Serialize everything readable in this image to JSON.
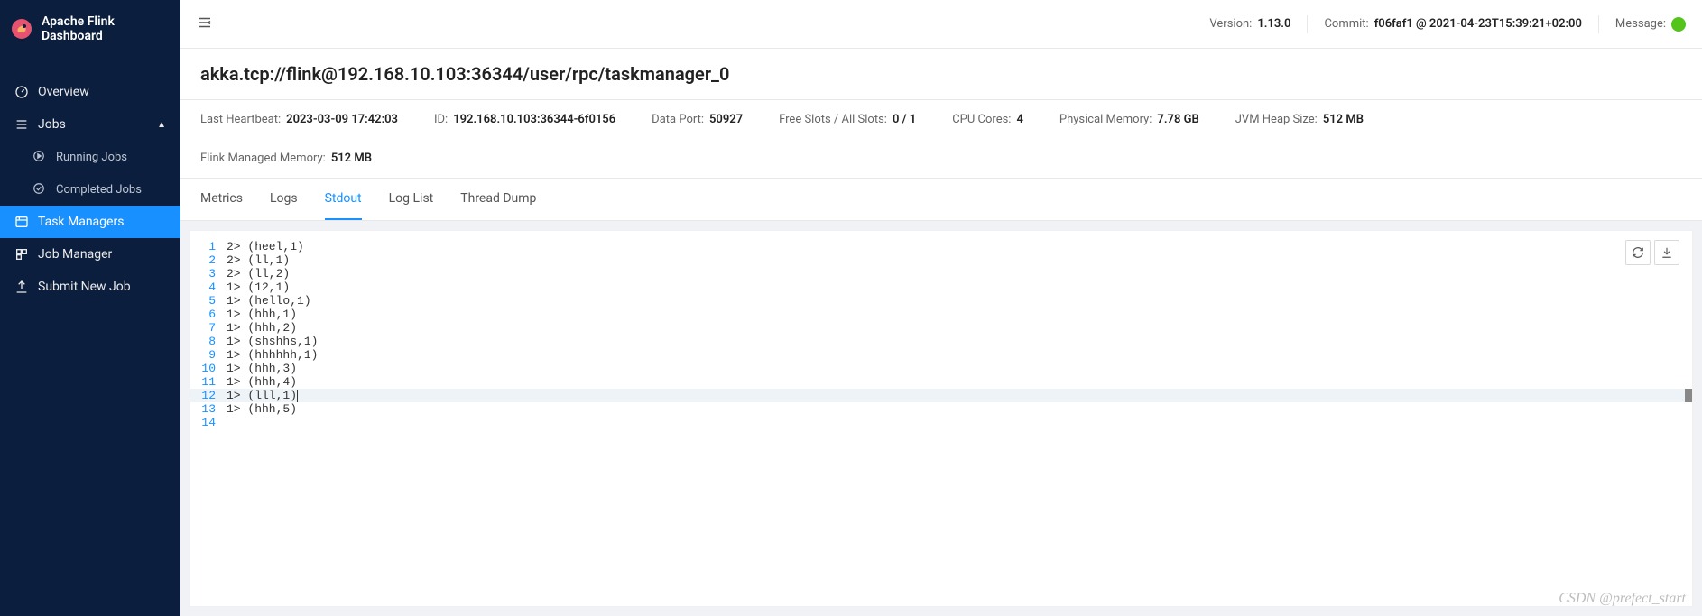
{
  "brand": {
    "title": "Apache Flink Dashboard"
  },
  "sidebar": {
    "overview": "Overview",
    "jobs": "Jobs",
    "running": "Running Jobs",
    "completed": "Completed Jobs",
    "task_managers": "Task Managers",
    "job_manager": "Job Manager",
    "submit": "Submit New Job"
  },
  "topbar": {
    "version_label": "Version:",
    "version": "1.13.0",
    "commit_label": "Commit:",
    "commit": "f06faf1 @ 2021-04-23T15:39:21+02:00",
    "message_label": "Message:"
  },
  "page": {
    "title": "akka.tcp://flink@192.168.10.103:36344/user/rpc/taskmanager_0"
  },
  "stats": {
    "last_heartbeat_label": "Last Heartbeat:",
    "last_heartbeat": "2023-03-09 17:42:03",
    "id_label": "ID:",
    "id": "192.168.10.103:36344-6f0156",
    "data_port_label": "Data Port:",
    "data_port": "50927",
    "slots_label": "Free Slots / All Slots:",
    "slots": "0 / 1",
    "cpu_label": "CPU Cores:",
    "cpu": "4",
    "phys_mem_label": "Physical Memory:",
    "phys_mem": "7.78 GB",
    "jvm_heap_label": "JVM Heap Size:",
    "jvm_heap": "512 MB",
    "managed_mem_label": "Flink Managed Memory:",
    "managed_mem": "512 MB"
  },
  "tabs": {
    "metrics": "Metrics",
    "logs": "Logs",
    "stdout": "Stdout",
    "loglist": "Log List",
    "threaddump": "Thread Dump"
  },
  "stdout": {
    "highlight_line": 12,
    "lines": [
      "2> (heel,1)",
      "2> (ll,1)",
      "2> (ll,2)",
      "1> (12,1)",
      "1> (hello,1)",
      "1> (hhh,1)",
      "1> (hhh,2)",
      "1> (shshhs,1)",
      "1> (hhhhhh,1)",
      "1> (hhh,3)",
      "1> (hhh,4)",
      "1> (lll,1)",
      "1> (hhh,5)",
      ""
    ]
  },
  "watermark": "CSDN @prefect_start"
}
